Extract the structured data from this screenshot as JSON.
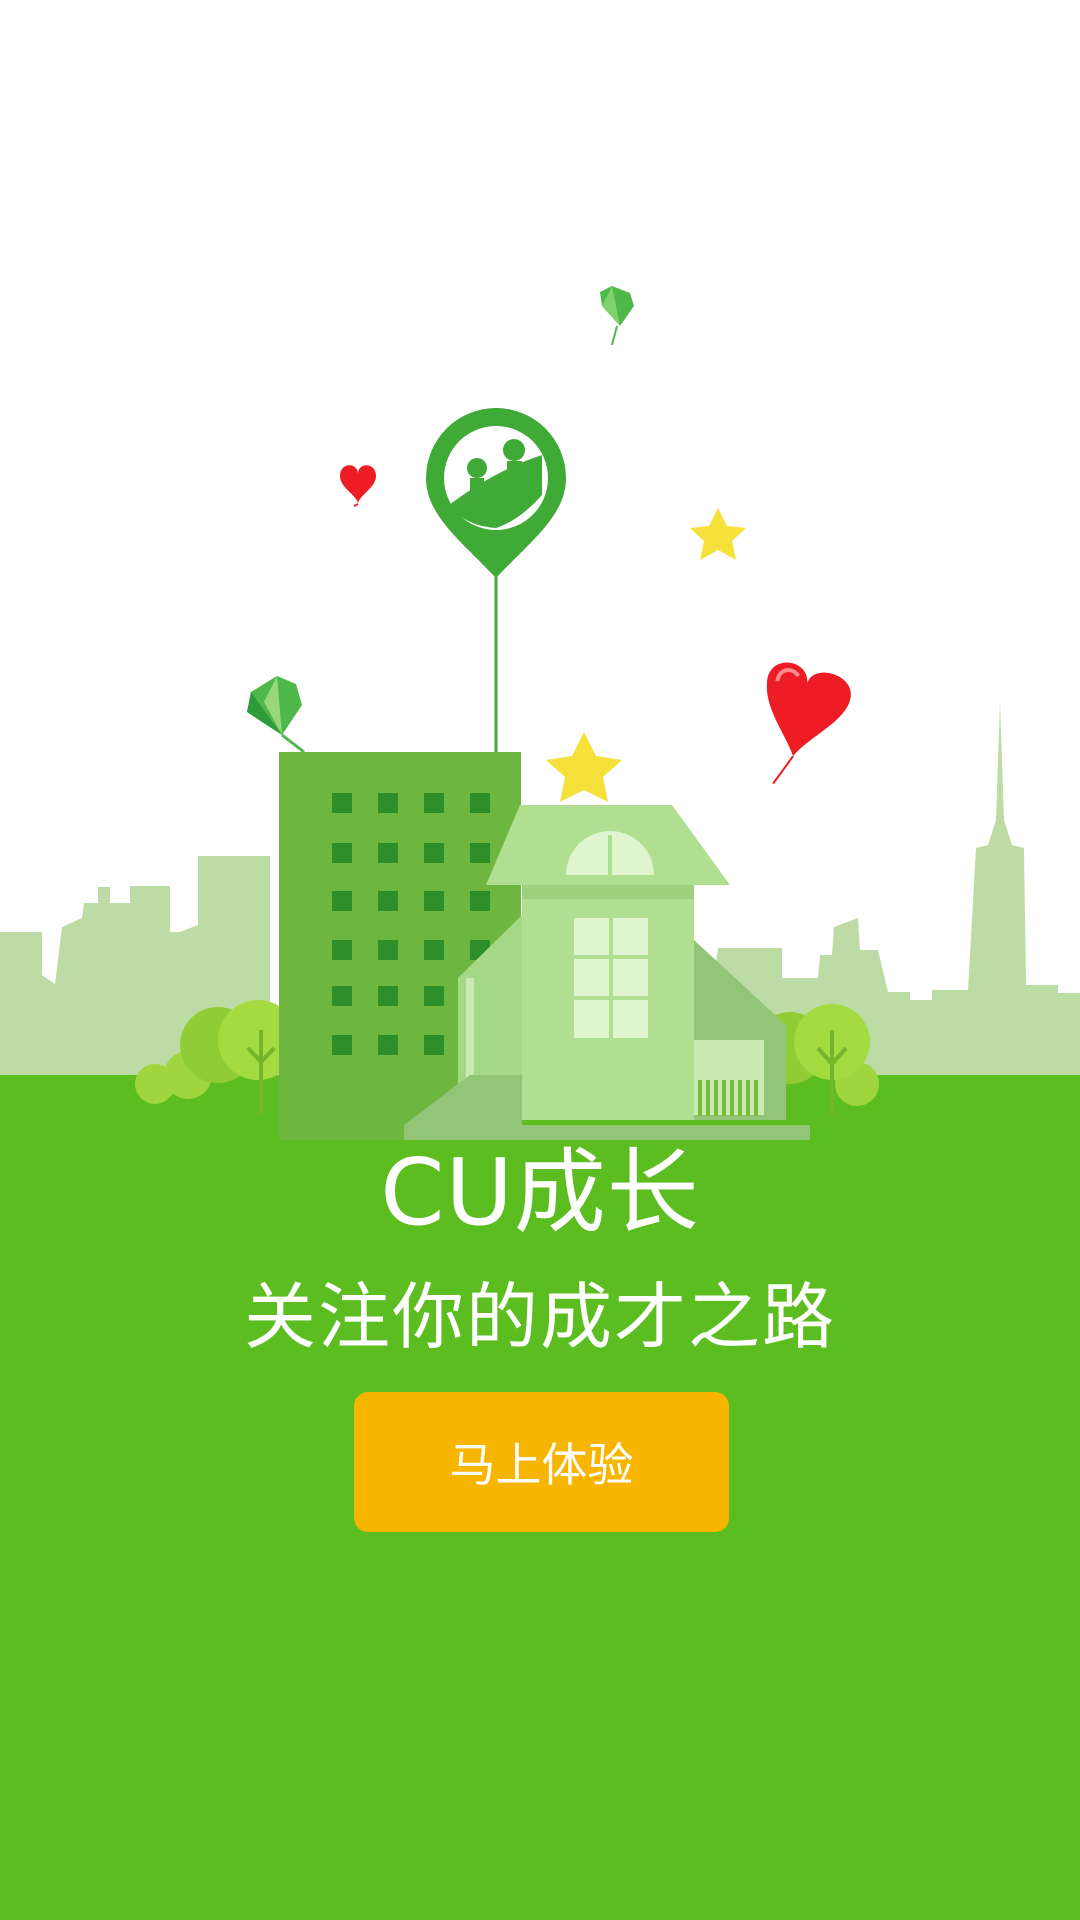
{
  "splash": {
    "title": "CU成长",
    "slogan": "关注你的成才之路",
    "start_button_label": "马上体验"
  },
  "colors": {
    "sky": "#ffffff",
    "ground": "#5bbd1f",
    "skyline": "#bddca5",
    "building_dark": "#6db640",
    "window_dark": "#2e8f2a",
    "house_light": "#b1df92",
    "house_window": "#dff5cf",
    "pin_green": "#3faa36",
    "button_orange": "#f7b500",
    "heart_red": "#ee1c25",
    "star_yellow": "#f5e13a"
  },
  "icons": [
    "app-logo-pin-icon",
    "heart-icon",
    "star-icon",
    "diamond-kite-icon"
  ]
}
